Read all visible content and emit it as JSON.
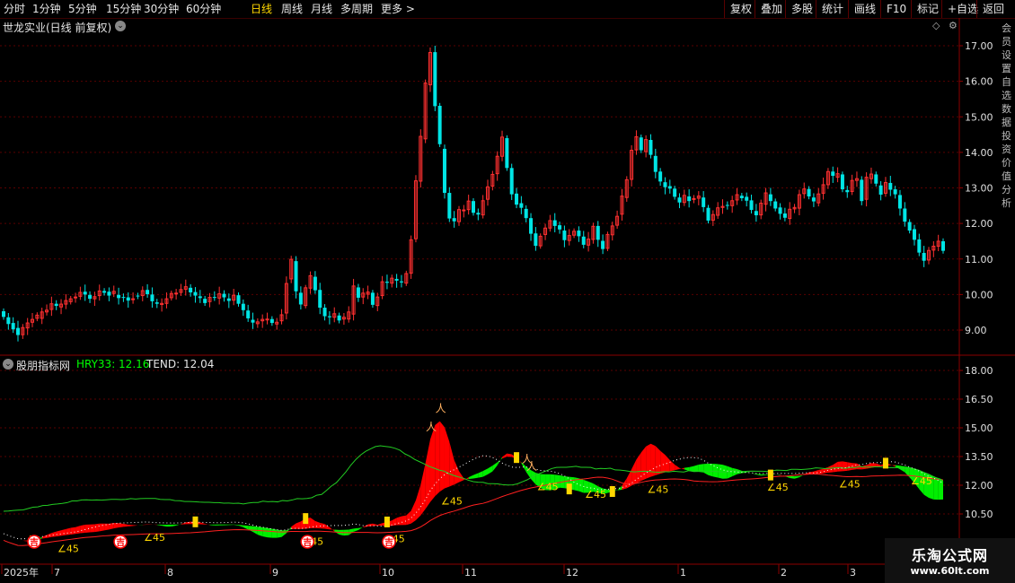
{
  "topbar": {
    "periods": [
      "分时",
      "1分钟",
      "5分钟",
      "15分钟",
      "30分钟",
      "60分钟",
      "日线",
      "周线",
      "月线",
      "多周期",
      "更多 >"
    ],
    "active_period": "日线",
    "right_buttons": [
      "复权",
      "叠加",
      "多股",
      "统计",
      "画线",
      "F10",
      "标记",
      "+自选",
      "返回"
    ]
  },
  "main_panel": {
    "title": "世龙实业(日线 前复权)",
    "y_ticks": [
      "17.00",
      "16.00",
      "15.00",
      "14.00",
      "13.00",
      "12.00",
      "11.00",
      "10.00",
      "9.00"
    ]
  },
  "indicator_panel": {
    "name": "股朋指标网",
    "hry33_label": "HRY33: 12.16",
    "tend_label": "TEND: 12.04",
    "y_ticks": [
      "18.00",
      "16.50",
      "15.00",
      "13.50",
      "12.00",
      "10.50"
    ],
    "angle_label": "∠45",
    "buy_label": "吉"
  },
  "x_axis": {
    "labels": [
      "2025年",
      "7",
      "8",
      "9",
      "10",
      "11",
      "12",
      "1",
      "2",
      "3"
    ]
  },
  "watermark": {
    "line1": "乐淘公式网",
    "line2": "www.60lt.com"
  },
  "side_text": "会员设置自选数据投资价值分析",
  "colors": {
    "up": "#ff3030",
    "down": "#00e5e5",
    "grid": "#5a0000",
    "yellow": "#ffd700",
    "green": "#00ff00"
  },
  "chart_data": {
    "type": "candlestick",
    "price_range": [
      8.6,
      17.5
    ],
    "indicator_range": [
      9.3,
      18.5
    ],
    "candles": [
      [
        9.53,
        9.37
      ],
      [
        9.36,
        9.17
      ],
      [
        9.2,
        9.02
      ],
      [
        9.06,
        8.86
      ],
      [
        8.87,
        9.07
      ],
      [
        9.06,
        9.2
      ],
      [
        9.22,
        9.3
      ],
      [
        9.33,
        9.42
      ],
      [
        9.33,
        9.51
      ],
      [
        9.51,
        9.56
      ],
      [
        9.58,
        9.74
      ],
      [
        9.74,
        9.68
      ],
      [
        9.65,
        9.73
      ],
      [
        9.73,
        9.83
      ],
      [
        9.8,
        9.88
      ],
      [
        9.93,
        9.93
      ],
      [
        9.95,
        10.06
      ],
      [
        10.08,
        10.0
      ],
      [
        9.99,
        9.88
      ],
      [
        9.88,
        9.94
      ],
      [
        9.97,
        10.1
      ],
      [
        10.1,
        10.05
      ],
      [
        10.08,
        9.97
      ],
      [
        10.03,
        10.09
      ],
      [
        9.99,
        9.9
      ],
      [
        9.93,
        9.91
      ],
      [
        9.92,
        9.83
      ],
      [
        9.88,
        9.88
      ],
      [
        9.97,
        9.95
      ],
      [
        9.97,
        10.11
      ],
      [
        10.13,
        10.01
      ],
      [
        10.0,
        9.81
      ],
      [
        9.78,
        9.74
      ],
      [
        9.72,
        9.75
      ],
      [
        9.75,
        9.88
      ],
      [
        9.91,
        10.03
      ],
      [
        10.02,
        10.04
      ],
      [
        10.06,
        10.14
      ],
      [
        10.15,
        10.22
      ],
      [
        10.19,
        10.06
      ],
      [
        10.07,
        9.97
      ],
      [
        9.95,
        9.9
      ],
      [
        9.88,
        9.76
      ],
      [
        9.8,
        9.92
      ],
      [
        9.93,
        9.92
      ],
      [
        9.9,
        10.02
      ],
      [
        10.02,
        9.92
      ],
      [
        9.89,
        9.82
      ],
      [
        9.84,
        9.98
      ],
      [
        9.98,
        9.74
      ],
      [
        9.74,
        9.56
      ],
      [
        9.55,
        9.33
      ],
      [
        9.29,
        9.21
      ],
      [
        9.18,
        9.23
      ],
      [
        9.26,
        9.3
      ],
      [
        9.3,
        9.31
      ],
      [
        9.31,
        9.2
      ],
      [
        9.17,
        9.22
      ],
      [
        9.26,
        9.43
      ],
      [
        9.48,
        10.31
      ],
      [
        10.44,
        10.99
      ],
      [
        10.94,
        10.09
      ],
      [
        10.05,
        9.72
      ],
      [
        9.69,
        10.19
      ],
      [
        10.18,
        10.53
      ],
      [
        10.5,
        10.12
      ],
      [
        10.13,
        9.63
      ],
      [
        9.63,
        9.39
      ],
      [
        9.39,
        9.36
      ],
      [
        9.36,
        9.46
      ],
      [
        9.41,
        9.27
      ],
      [
        9.31,
        9.36
      ],
      [
        9.31,
        9.51
      ],
      [
        9.45,
        10.24
      ],
      [
        10.2,
        9.91
      ],
      [
        9.93,
        10.04
      ],
      [
        10.01,
        10.07
      ],
      [
        10.05,
        9.71
      ],
      [
        9.69,
        9.93
      ],
      [
        9.97,
        10.36
      ],
      [
        10.36,
        10.33
      ],
      [
        10.32,
        10.46
      ],
      [
        10.44,
        10.39
      ],
      [
        10.37,
        10.34
      ],
      [
        10.32,
        10.59
      ],
      [
        10.6,
        11.54
      ],
      [
        11.57,
        13.2
      ],
      [
        13.19,
        14.45
      ],
      [
        14.38,
        15.95
      ],
      [
        15.9,
        16.81
      ],
      [
        16.82,
        15.3
      ],
      [
        15.31,
        14.23
      ],
      [
        14.1,
        12.86
      ],
      [
        12.86,
        12.14
      ],
      [
        12.15,
        12.06
      ],
      [
        12.05,
        12.39
      ],
      [
        12.37,
        12.38
      ],
      [
        12.39,
        12.63
      ],
      [
        12.63,
        12.3
      ],
      [
        12.3,
        12.25
      ],
      [
        12.24,
        12.64
      ],
      [
        12.68,
        13.03
      ],
      [
        13.05,
        13.38
      ],
      [
        13.4,
        13.89
      ],
      [
        13.89,
        14.43
      ],
      [
        14.4,
        13.56
      ],
      [
        13.56,
        12.82
      ],
      [
        12.84,
        12.53
      ],
      [
        12.57,
        12.44
      ],
      [
        12.41,
        12.15
      ],
      [
        12.15,
        11.71
      ],
      [
        11.72,
        11.37
      ],
      [
        11.37,
        11.64
      ],
      [
        11.69,
        11.87
      ],
      [
        11.87,
        12.08
      ],
      [
        12.09,
        11.93
      ],
      [
        11.95,
        11.83
      ],
      [
        11.8,
        11.53
      ],
      [
        11.52,
        11.66
      ],
      [
        11.67,
        11.78
      ],
      [
        11.8,
        11.64
      ],
      [
        11.63,
        11.4
      ],
      [
        11.39,
        11.56
      ],
      [
        11.55,
        11.92
      ],
      [
        11.93,
        11.54
      ],
      [
        11.51,
        11.28
      ],
      [
        11.3,
        11.69
      ],
      [
        11.68,
        11.93
      ],
      [
        11.95,
        12.2
      ],
      [
        12.26,
        12.77
      ],
      [
        12.73,
        13.23
      ],
      [
        13.24,
        14.06
      ],
      [
        14.07,
        14.44
      ],
      [
        14.42,
        14.06
      ],
      [
        14.02,
        14.36
      ],
      [
        14.35,
        13.93
      ],
      [
        13.9,
        13.45
      ],
      [
        13.46,
        13.18
      ],
      [
        13.16,
        13.02
      ],
      [
        13.05,
        12.98
      ],
      [
        12.98,
        12.75
      ],
      [
        12.73,
        12.59
      ],
      [
        12.59,
        12.79
      ],
      [
        12.76,
        12.63
      ],
      [
        12.69,
        12.7
      ],
      [
        12.71,
        12.77
      ],
      [
        12.73,
        12.46
      ],
      [
        12.44,
        12.08
      ],
      [
        12.09,
        12.25
      ],
      [
        12.23,
        12.44
      ],
      [
        12.45,
        12.48
      ],
      [
        12.52,
        12.51
      ],
      [
        12.5,
        12.64
      ],
      [
        12.66,
        12.81
      ],
      [
        12.78,
        12.71
      ],
      [
        12.75,
        12.64
      ],
      [
        12.65,
        12.38
      ],
      [
        12.35,
        12.23
      ],
      [
        12.24,
        12.57
      ],
      [
        12.54,
        12.86
      ],
      [
        12.82,
        12.63
      ],
      [
        12.62,
        12.42
      ],
      [
        12.45,
        12.27
      ],
      [
        12.28,
        12.16
      ],
      [
        12.14,
        12.4
      ],
      [
        12.41,
        12.45
      ],
      [
        12.43,
        12.81
      ],
      [
        12.84,
        12.97
      ],
      [
        12.97,
        12.76
      ],
      [
        12.73,
        12.62
      ],
      [
        12.58,
        12.83
      ],
      [
        12.85,
        13.09
      ],
      [
        13.09,
        13.46
      ],
      [
        13.46,
        13.34
      ],
      [
        13.3,
        13.4
      ],
      [
        13.38,
        12.96
      ],
      [
        12.94,
        12.88
      ],
      [
        12.9,
        13.21
      ],
      [
        13.21,
        13.26
      ],
      [
        13.23,
        12.63
      ],
      [
        12.68,
        13.3
      ],
      [
        13.26,
        13.39
      ],
      [
        13.38,
        13.12
      ],
      [
        13.07,
        12.81
      ],
      [
        12.85,
        13.15
      ],
      [
        13.14,
        12.95
      ],
      [
        12.96,
        12.82
      ],
      [
        12.8,
        12.42
      ],
      [
        12.42,
        12.05
      ],
      [
        12.04,
        11.8
      ],
      [
        11.84,
        11.54
      ],
      [
        11.55,
        11.18
      ],
      [
        11.17,
        10.95
      ],
      [
        10.97,
        11.24
      ],
      [
        11.25,
        11.36
      ],
      [
        11.36,
        11.5
      ],
      [
        11.5,
        11.23
      ]
    ],
    "indicator": {
      "hry33": 12.16,
      "tend": 12.04,
      "upper_line": [
        10.64,
        10.65,
        10.68,
        10.7,
        10.71,
        10.78,
        10.85,
        10.87,
        10.94,
        10.95,
        11.0,
        11.02,
        11.05,
        11.09,
        11.18,
        11.18,
        11.23,
        11.24,
        11.22,
        11.23,
        11.22,
        11.24,
        11.26,
        11.26,
        11.25,
        11.26,
        11.3,
        11.28,
        11.3,
        11.31,
        11.31,
        11.31,
        11.26,
        11.25,
        11.25,
        11.2,
        11.19,
        11.15,
        11.15,
        11.14,
        11.12,
        11.11,
        11.11,
        11.09,
        11.09,
        11.06,
        11.07,
        11.05,
        11.06,
        11.02,
        11.07,
        11.1,
        11.1,
        11.17,
        11.14,
        11.15,
        11.13,
        11.2,
        11.18,
        11.23,
        11.3,
        11.29,
        11.31,
        11.35,
        11.48,
        11.52,
        11.73,
        11.96,
        12.13,
        12.42,
        12.71,
        13.06,
        13.35,
        13.59,
        13.77,
        13.9,
        14.02,
        14.06,
        14.03,
        14.0,
        13.93,
        13.83,
        13.64,
        13.52,
        13.35,
        13.23,
        13.11,
        12.98,
        12.89,
        12.79,
        12.74,
        12.61,
        12.51,
        12.43,
        12.36,
        12.26,
        12.19,
        12.16,
        12.15,
        12.08,
        12.08,
        12.07,
        12.03,
        12.01,
        12.02,
        12.07,
        12.18,
        12.28,
        12.43,
        12.55,
        12.66,
        12.76,
        12.87,
        12.93,
        12.94,
        12.94,
        12.96,
        12.99,
        12.94,
        12.94,
        12.93,
        12.85,
        12.88,
        12.87,
        12.89,
        12.8,
        12.79,
        12.76,
        12.72,
        12.7,
        12.72,
        12.73,
        12.72,
        12.69,
        12.68,
        12.71,
        12.7,
        12.73,
        12.71,
        12.69,
        12.76,
        12.72,
        12.74,
        12.75,
        12.7,
        12.73,
        12.71,
        12.69,
        12.69,
        12.77,
        12.74,
        12.71,
        12.73,
        12.74,
        12.73,
        12.73,
        12.72,
        12.75,
        12.79,
        12.78,
        12.77,
        12.83,
        12.83,
        12.82,
        12.84,
        12.86,
        12.91,
        12.89,
        12.87,
        12.89,
        12.91,
        12.92,
        12.88,
        12.93,
        12.92,
        12.98,
        12.95,
        12.95,
        12.96,
        12.96,
        12.94,
        12.92,
        12.92,
        12.92,
        12.87,
        12.86,
        12.86,
        12.79,
        12.68,
        12.58,
        12.46,
        12.34,
        12.23
      ]
    }
  }
}
